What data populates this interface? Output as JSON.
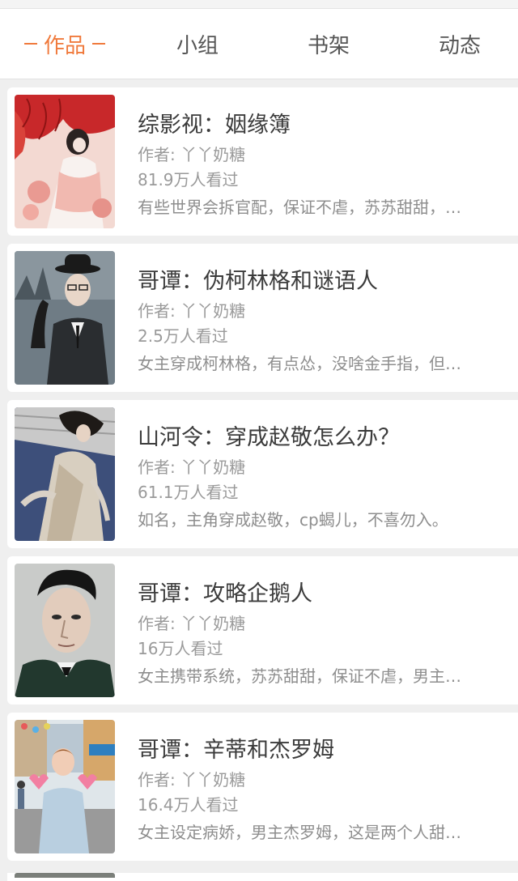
{
  "tabs": [
    {
      "label": "作品",
      "active": true
    },
    {
      "label": "小组",
      "active": false
    },
    {
      "label": "书架",
      "active": false
    },
    {
      "label": "动态",
      "active": false
    }
  ],
  "works": [
    {
      "title": "综影视：姻缘簿",
      "author": "作者: 丫丫奶糖",
      "views": "81.9万人看过",
      "desc": "有些世界会拆官配，保证不虐，苏苏甜甜，…"
    },
    {
      "title": "哥谭：伪柯林格和谜语人",
      "author": "作者: 丫丫奶糖",
      "views": "2.5万人看过",
      "desc": "女主穿成柯林格，有点怂，没啥金手指，但…"
    },
    {
      "title": "山河令：穿成赵敬怎么办？",
      "author": "作者: 丫丫奶糖",
      "views": "61.1万人看过",
      "desc": "如名，主角穿成赵敬，cp蝎儿，不喜勿入。"
    },
    {
      "title": "哥谭：攻略企鹅人",
      "author": "作者: 丫丫奶糖",
      "views": "16万人看过",
      "desc": "女主携带系统，苏苏甜甜，保证不虐，男主…"
    },
    {
      "title": "哥谭：辛蒂和杰罗姆",
      "author": "作者: 丫丫奶糖",
      "views": "16.4万人看过",
      "desc": "女主设定病娇，男主杰罗姆，这是两个人甜…"
    }
  ],
  "colors": {
    "accent": "#f07a3c",
    "background": "#efefef",
    "card": "#ffffff",
    "title_text": "#3b3b3b",
    "meta_text": "#9a9a9a"
  }
}
